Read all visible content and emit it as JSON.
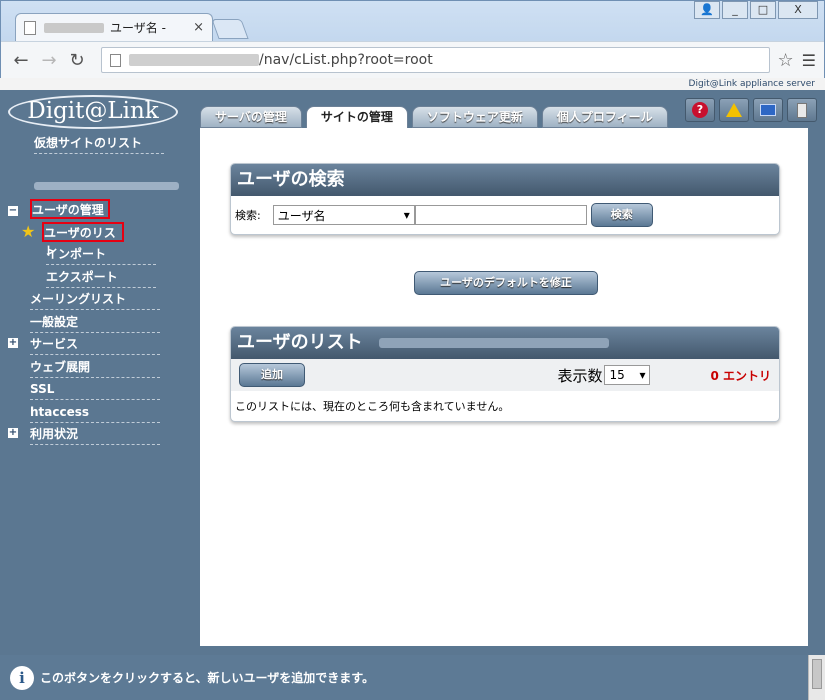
{
  "browser": {
    "tab_title": "ユーザ名 - ",
    "close": "×",
    "url_path": "/nav/cList.php?root=root",
    "window_buttons": [
      "👤",
      "_",
      "□",
      "X"
    ]
  },
  "brand": {
    "tagline": "Digit@Link appliance server",
    "logo": "Digit@Link"
  },
  "top_tabs": [
    {
      "label": "サーバの管理",
      "active": false
    },
    {
      "label": "サイトの管理",
      "active": true
    },
    {
      "label": "ソフトウェア更新",
      "active": false
    },
    {
      "label": "個人プロフィール",
      "active": false
    }
  ],
  "header_icons": [
    "help-icon",
    "warning-icon",
    "screen-icon",
    "logout-icon"
  ],
  "sidebar": {
    "virtual_site_list": "仮想サイトのリスト",
    "user_mgmt": "ユーザの管理",
    "user_list": "ユーザのリスト",
    "import": "インポート",
    "export": "エクスポート",
    "mailing_list": "メーリングリスト",
    "general": "一般設定",
    "services": "サービス",
    "web_deploy": "ウェブ展開",
    "ssl": "SSL",
    "htaccess": "htaccess",
    "usage": "利用状況"
  },
  "search_panel": {
    "title": "ユーザの検索",
    "label": "検索:",
    "select_value": "ユーザ名",
    "button": "検索"
  },
  "defaults_button": "ユーザのデフォルトを修正",
  "list_panel": {
    "title": "ユーザのリスト",
    "add_button": "追加",
    "display_label": "表示数",
    "display_value": "15",
    "entries": "0 エントリ",
    "empty_message": "このリストには、現在のところ何も含まれていません。"
  },
  "status_text": "このボタンをクリックすると、新しいユーザを追加できます。"
}
